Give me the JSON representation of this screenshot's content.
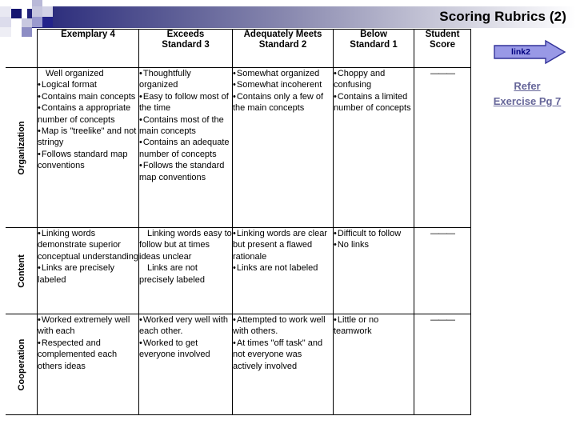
{
  "header": {
    "title": "Scoring Rubrics (2)",
    "gradient_from": "#20217a",
    "gradient_to": "#ffffff"
  },
  "table": {
    "corner_label": "",
    "columns": [
      "Exemplary 4",
      "Exceeds\nStandard 3",
      "Adequately Meets\nStandard 2",
      "Below\nStandard 1",
      "Student\nScore"
    ],
    "columns_flat": [
      "Exemplary 4",
      "Exceeds Standard 3",
      "Adequately Meets Standard 2",
      "Below Standard 1",
      "Student Score"
    ],
    "score_placeholder": "———",
    "rows": [
      {
        "label": "Organization",
        "exemplary": [
          {
            "bullet": false,
            "text": "Well organized"
          },
          {
            "bullet": true,
            "text": "Logical format"
          },
          {
            "bullet": true,
            "text": "Contains main concepts"
          },
          {
            "bullet": true,
            "text": "Contains a appropriate number of concepts"
          },
          {
            "bullet": true,
            "text": "Map is \"treelike\" and not stringy"
          },
          {
            "bullet": true,
            "text": "Follows standard map conventions"
          }
        ],
        "exceeds": [
          {
            "bullet": true,
            "text": "Thoughtfully organized"
          },
          {
            "bullet": true,
            "text": "Easy to follow most of the time"
          },
          {
            "bullet": true,
            "text": "Contains most of the main concepts"
          },
          {
            "bullet": true,
            "text": "Contains an adequate number of concepts"
          },
          {
            "bullet": true,
            "text": "Follows the standard map conventions"
          }
        ],
        "adequate": [
          {
            "bullet": true,
            "text": "Somewhat organized"
          },
          {
            "bullet": true,
            "text": "Somewhat incoherent"
          },
          {
            "bullet": true,
            "text": "Contains only a few of the main concepts"
          }
        ],
        "below": [
          {
            "bullet": true,
            "text": "Choppy and confusing"
          },
          {
            "bullet": true,
            "text": "Contains a limited number of concepts"
          }
        ]
      },
      {
        "label": "Content",
        "exemplary": [
          {
            "bullet": true,
            "text": "Linking words demonstrate superior conceptual understanding"
          },
          {
            "bullet": true,
            "text": "Links are precisely labeled"
          }
        ],
        "exceeds": [
          {
            "bullet": false,
            "text": "Linking words easy to follow but at times ideas unclear"
          },
          {
            "bullet": false,
            "text": "Links are not precisely labeled"
          }
        ],
        "adequate": [
          {
            "bullet": true,
            "text": "Linking words are clear but present a flawed rationale"
          },
          {
            "bullet": true,
            "text": "Links are not labeled"
          }
        ],
        "below": [
          {
            "bullet": true,
            "text": "Difficult to follow"
          },
          {
            "bullet": true,
            "text": "No links"
          }
        ]
      },
      {
        "label": "Cooperation",
        "exemplary": [
          {
            "bullet": true,
            "text": "Worked extremely well with each"
          },
          {
            "bullet": true,
            "text": "Respected and complemented each others ideas"
          }
        ],
        "exceeds": [
          {
            "bullet": true,
            "text": "Worked very well with each other."
          },
          {
            "bullet": true,
            "text": "Worked to get everyone involved"
          }
        ],
        "adequate": [
          {
            "bullet": true,
            "text": "Attempted to work well with others."
          },
          {
            "bullet": true,
            "text": "At times \"off task\" and not everyone was actively involved"
          }
        ],
        "below": [
          {
            "bullet": true,
            "text": "Little or no teamwork"
          }
        ]
      }
    ]
  },
  "sidebar": {
    "arrow_button_label": "link2",
    "arrow_fill": "#9999e6",
    "arrow_stroke": "#333399",
    "refer_line1": "Refer",
    "refer_line2": "Exercise Pg 7",
    "refer_color": "#666699"
  }
}
